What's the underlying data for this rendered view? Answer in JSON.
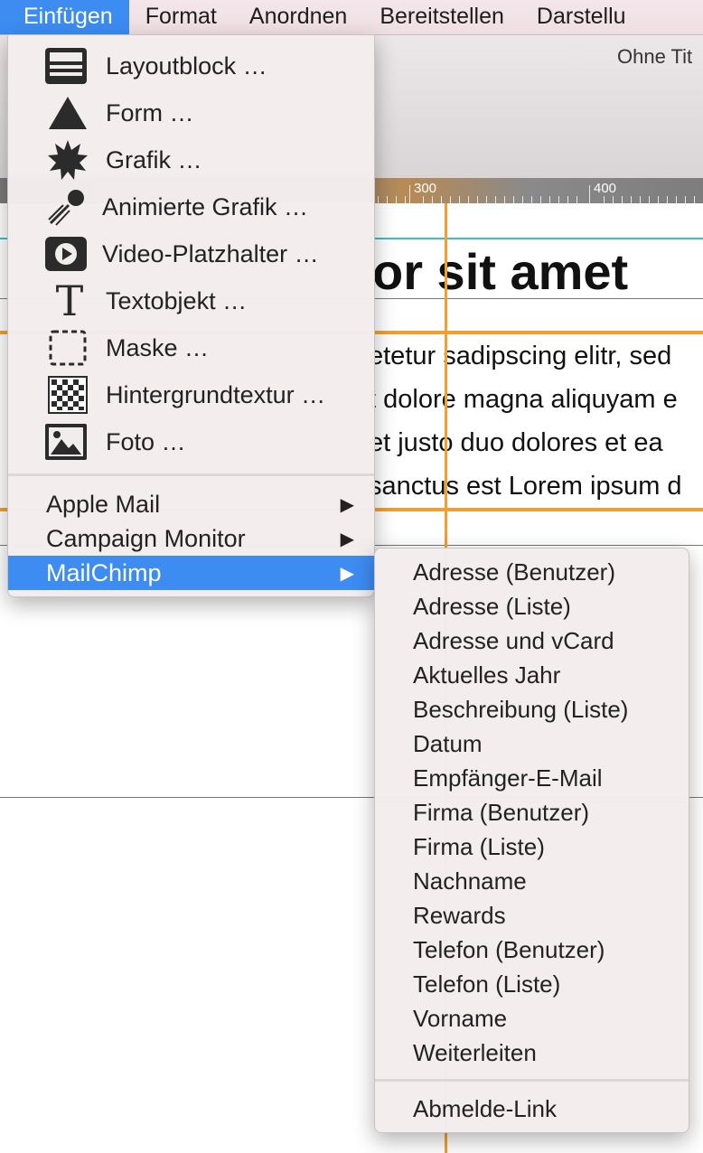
{
  "menubar": {
    "items": [
      "Einfügen",
      "Format",
      "Anordnen",
      "Bereitstellen",
      "Darstellu"
    ]
  },
  "window": {
    "title": "Ohne Tit",
    "ruler": {
      "labels": [
        "300",
        "400"
      ]
    },
    "headline": "or sit amet",
    "body_lines": [
      "etetur sadipscing elitr, sed",
      "t dolore magna aliquyam e",
      "et justo duo dolores et ea",
      "sanctus est Lorem ipsum d"
    ]
  },
  "insert_menu": {
    "items": [
      {
        "label": "Layoutblock …",
        "icon": "layout-block-icon"
      },
      {
        "label": "Form …",
        "icon": "triangle-shape-icon"
      },
      {
        "label": "Grafik …",
        "icon": "starburst-graphic-icon"
      },
      {
        "label": "Animierte Grafik …",
        "icon": "animated-graphic-icon"
      },
      {
        "label": "Video-Platzhalter …",
        "icon": "video-play-icon"
      },
      {
        "label": "Textobjekt …",
        "icon": "text-t-icon"
      },
      {
        "label": "Maske …",
        "icon": "mask-dashed-icon"
      },
      {
        "label": "Hintergrundtextur …",
        "icon": "checkerboard-texture-icon"
      },
      {
        "label": "Foto …",
        "icon": "photo-icon"
      }
    ],
    "submenus": [
      {
        "label": "Apple Mail",
        "selected": false
      },
      {
        "label": "Campaign Monitor",
        "selected": false
      },
      {
        "label": "MailChimp",
        "selected": true
      }
    ],
    "selection_color": "#3d8cf2"
  },
  "mailchimp_submenu": {
    "items": [
      "Adresse (Benutzer)",
      "Adresse (Liste)",
      "Adresse und vCard",
      "Aktuelles Jahr",
      "Beschreibung (Liste)",
      "Datum",
      "Empfänger-E-Mail",
      "Firma (Benutzer)",
      "Firma (Liste)",
      "Nachname",
      "Rewards",
      "Telefon (Benutzer)",
      "Telefon (Liste)",
      "Vorname",
      "Weiterleiten"
    ],
    "footer_item": "Abmelde-Link"
  }
}
